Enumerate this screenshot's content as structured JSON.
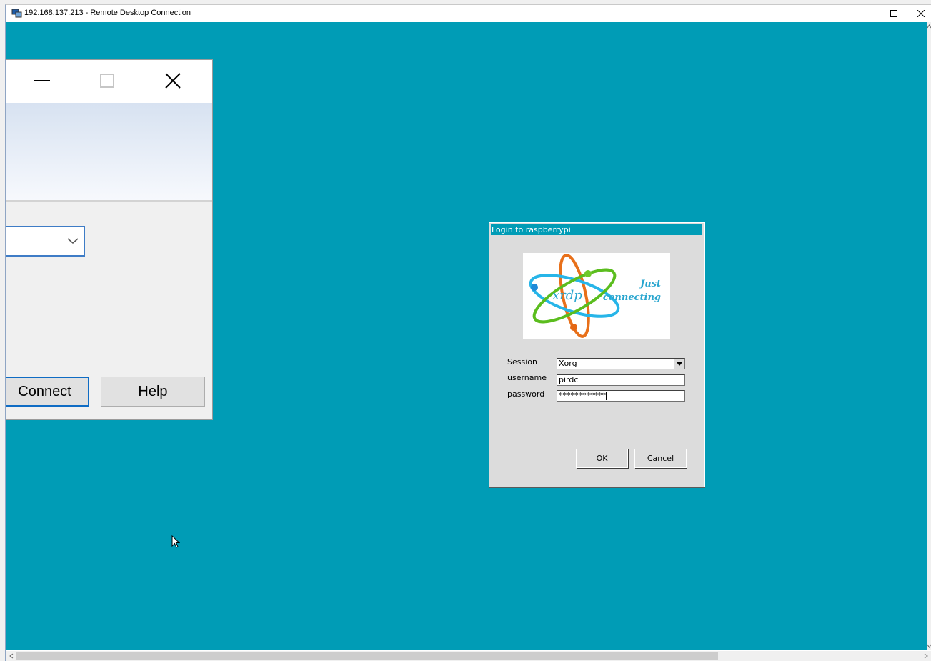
{
  "window": {
    "title": "192.168.137.213 - Remote Desktop Connection",
    "icons": [
      "rdp-app-icon",
      "minimize-icon",
      "maximize-icon",
      "close-icon"
    ]
  },
  "rdc_window": {
    "icons": [
      "minimize-icon",
      "maximize-icon",
      "close-icon",
      "chevron-down-icon"
    ],
    "connect_label": "Connect",
    "help_label": "Help"
  },
  "login_dialog": {
    "title": "Login to raspberrypi",
    "logo_text": "xrdp",
    "tagline_1": "Just",
    "tagline_2": "connecting",
    "session_label": "Session",
    "session_value": "Xorg",
    "username_label": "username",
    "username_value": "pirdc",
    "password_label": "password",
    "password_value": "************",
    "ok_label": "OK",
    "cancel_label": "Cancel"
  },
  "colors": {
    "desktop": "#009cb6",
    "dialog": "#dcdcdc",
    "accent": "#3e7cc6"
  }
}
